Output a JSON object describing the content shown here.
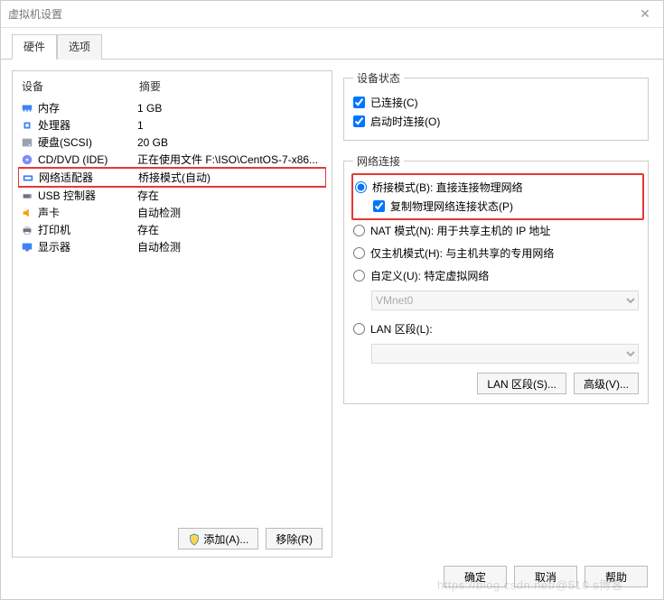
{
  "window": {
    "title": "虚拟机设置"
  },
  "tabs": {
    "hardware": "硬件",
    "options": "选项"
  },
  "list_header": {
    "device": "设备",
    "summary": "摘要"
  },
  "devices": [
    {
      "icon": "memory",
      "name": "内存",
      "summary": "1 GB",
      "selected": false
    },
    {
      "icon": "cpu",
      "name": "处理器",
      "summary": "1",
      "selected": false
    },
    {
      "icon": "disk",
      "name": "硬盘(SCSI)",
      "summary": "20 GB",
      "selected": false
    },
    {
      "icon": "cd",
      "name": "CD/DVD (IDE)",
      "summary": "正在使用文件 F:\\ISO\\CentOS-7-x86...",
      "selected": false
    },
    {
      "icon": "net",
      "name": "网络适配器",
      "summary": "桥接模式(自动)",
      "selected": true
    },
    {
      "icon": "usb",
      "name": "USB 控制器",
      "summary": "存在",
      "selected": false
    },
    {
      "icon": "sound",
      "name": "声卡",
      "summary": "自动检测",
      "selected": false
    },
    {
      "icon": "printer",
      "name": "打印机",
      "summary": "存在",
      "selected": false
    },
    {
      "icon": "display",
      "name": "显示器",
      "summary": "自动检测",
      "selected": false
    }
  ],
  "left_buttons": {
    "add": "添加(A)...",
    "remove": "移除(R)"
  },
  "device_state": {
    "legend": "设备状态",
    "connected": "已连接(C)",
    "connect_at_power": "启动时连接(O)"
  },
  "net_conn": {
    "legend": "网络连接",
    "bridged": "桥接模式(B): 直接连接物理网络",
    "replicate": "复制物理网络连接状态(P)",
    "nat": "NAT 模式(N): 用于共享主机的 IP 地址",
    "hostonly": "仅主机模式(H): 与主机共享的专用网络",
    "custom": "自定义(U): 特定虚拟网络",
    "custom_value": "VMnet0",
    "lan_segment": "LAN 区段(L):",
    "lan_value": ""
  },
  "right_buttons": {
    "lan": "LAN 区段(S)...",
    "advanced": "高级(V)..."
  },
  "dialog_buttons": {
    "ok": "确定",
    "cancel": "取消",
    "help": "帮助"
  },
  "watermark": "https://blog.csdn.net/@510 s博客"
}
